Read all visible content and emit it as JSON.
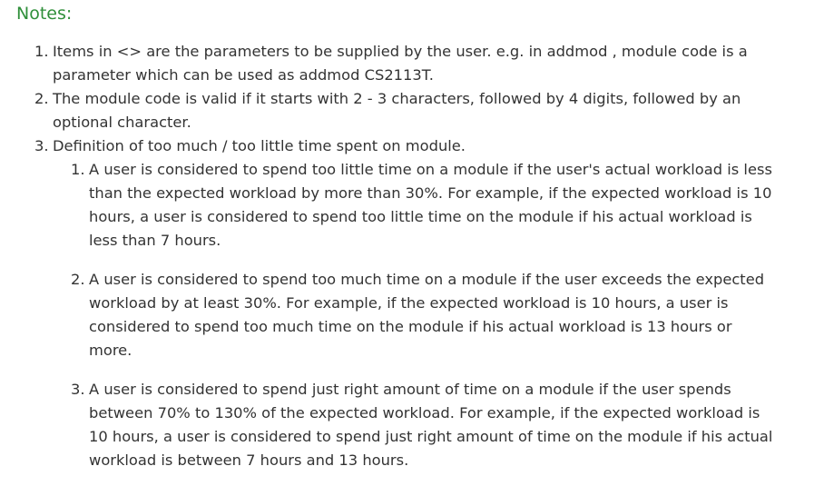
{
  "heading": "Notes:",
  "items": [
    {
      "num": "1.",
      "text": "Items in <> are the parameters to be supplied by the user. e.g. in addmod , module code is a parameter which can be used as addmod CS2113T."
    },
    {
      "num": "2.",
      "text": "The module code is valid if it starts with 2 - 3 characters, followed by 4 digits, followed by an optional character."
    },
    {
      "num": "3.",
      "text": "Definition of too much / too little time spent on module.",
      "subitems": [
        {
          "num": "1.",
          "text": "A user is considered to spend too little time on a module if the user's actual workload is less than the expected workload by more than 30%. For example, if the expected workload is 10 hours, a user is considered to spend too little time on the module if his actual workload is less than 7 hours."
        },
        {
          "num": "2.",
          "text": "A user is considered to spend too much time on a module if the user exceeds the expected workload by at least 30%. For example, if the expected workload is 10 hours, a user is considered to spend too much time on the module if his actual workload is 13 hours or more."
        },
        {
          "num": "3.",
          "text": "A user is considered to spend just right amount of time on a module if the user spends between 70% to 130% of the expected workload. For example, if the expected workload is 10 hours, a user is considered to spend just right amount of time on the module if his actual workload is between 7 hours and 13 hours."
        }
      ]
    }
  ]
}
